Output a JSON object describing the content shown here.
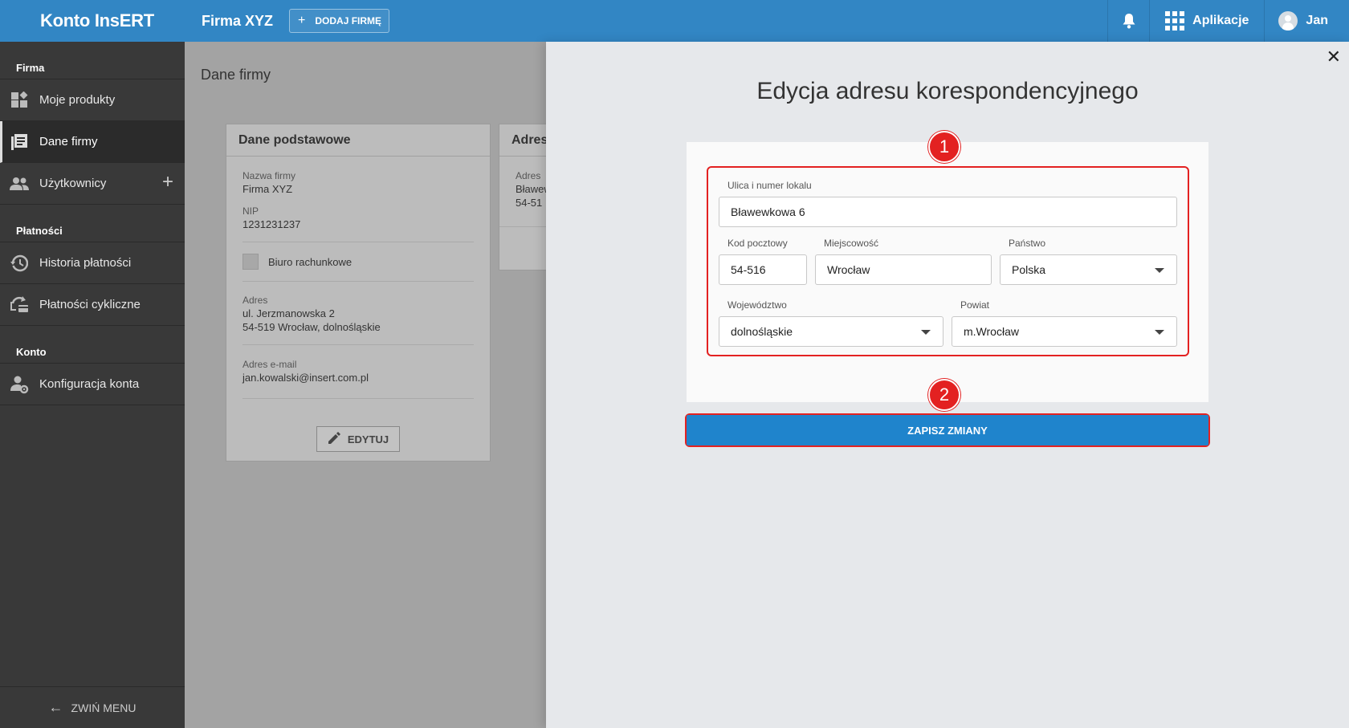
{
  "topbar": {
    "brand": "Konto InsERT",
    "firm_name": "Firma XYZ",
    "add_firm_label": "DODAJ FIRMĘ",
    "apps_label": "Aplikacje",
    "user_name": "Jan"
  },
  "sidebar": {
    "sections": [
      {
        "title": "Firma"
      },
      {
        "title": "Płatności"
      },
      {
        "title": "Konto"
      }
    ],
    "items": {
      "moje_produkty": "Moje produkty",
      "dane_firmy": "Dane firmy",
      "uzytkownicy": "Użytkownicy",
      "historia_platnosci": "Historia płatności",
      "platnosci_cykliczne": "Płatności cykliczne",
      "konfiguracja_konta": "Konfiguracja konta"
    },
    "collapse_label": "ZWIŃ MENU"
  },
  "main": {
    "page_title": "Dane firmy",
    "card_basic": {
      "title": "Dane podstawowe",
      "firm_name_label": "Nazwa firmy",
      "firm_name_value": "Firma XYZ",
      "nip_label": "NIP",
      "nip_value": "1231231237",
      "checkbox_label": "Biuro rachunkowe",
      "address_label": "Adres",
      "address_line1": "ul. Jerzmanowska 2",
      "address_line2": "54-519 Wrocław, dolnośląskie",
      "email_label": "Adres e-mail",
      "email_value": "jan.kowalski@insert.com.pl",
      "edit_label": "EDYTUJ"
    },
    "card_address": {
      "title": "Adres",
      "label": "Adres",
      "line1": "Bławew",
      "line2": "54-51"
    }
  },
  "drawer": {
    "title": "Edycja adresu korespondencyjnego",
    "badge1": "1",
    "badge2": "2",
    "fields": {
      "street_label": "Ulica i numer lokalu",
      "street_value": "Bławewkowa 6",
      "postal_label": "Kod pocztowy",
      "postal_value": "54-516",
      "city_label": "Miejscowość",
      "city_value": "Wrocław",
      "country_label": "Państwo",
      "country_value": "Polska",
      "voivodeship_label": "Województwo",
      "voivodeship_value": "dolnośląskie",
      "county_label": "Powiat",
      "county_value": "m.Wrocław"
    },
    "save_label": "ZAPISZ ZMIANY"
  },
  "colors": {
    "topbar": "#3286c4",
    "sidebar": "#393939",
    "highlight": "#e32121",
    "save_button": "#1f84cc"
  }
}
